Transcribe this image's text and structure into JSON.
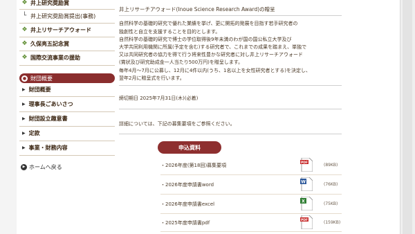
{
  "sidebar": {
    "items_top": [
      {
        "label": "井上研究奨励賞",
        "icon": "leaf-icon"
      },
      {
        "label": "井上研究奨励賞提出(事務)",
        "icon": "corner-arrow-icon"
      },
      {
        "label": "井上リサーチアウォード",
        "icon": "leaf-icon"
      },
      {
        "label": "久保亮五記念賞",
        "icon": "leaf-icon"
      },
      {
        "label": "国際交流事業の援助",
        "icon": "leaf-icon"
      }
    ],
    "section_title": "財団概要",
    "items_sub": [
      "財団概要",
      "理事長ごあいさつ",
      "財団設立趣意書",
      "定款",
      "事業・財務内容"
    ],
    "home_label": "ホームへ戻る"
  },
  "content": {
    "heading": "井上リサーチアウォード(Inoue Science Research Award)の贈呈",
    "para1": [
      "自然科学の基礎的研究で優れた業績を挙げ、更に開拓的発展を目指す若手研究者の",
      "独創性と自立を支援することを目的とします。",
      "自然科学の基礎的研究で博士の学位取得後9年未満のわが国の国公私立大学及び",
      "大学共同利用機関に所属(予定を含む)する研究者で、これまでの成果を踏まえ、単独で",
      "又は共同研究者の協力を得て行う将来性豊かな研究者に対し井上リサーチアウォード",
      "(賞状及び研究助成金一人当たり500万円)を贈呈します。",
      "毎年4月〜7月に公募し、12月に4件以内(うち、1名以上を女性研究者とする)を決定し、",
      "翌年2月に贈呈式を行います。"
    ],
    "deadline": "締切期日 2025年7月31日(木)(必着)",
    "details": "詳細については、下記の募集要項をご参照ください。",
    "apply_button": "申込資料",
    "files": [
      {
        "label": "・2026年度(第18回)募集要項",
        "type": "pdf",
        "badge": "PDF",
        "size": "(89KB)"
      },
      {
        "label": "・2026年度申請書word",
        "type": "word",
        "badge": "W",
        "size": "(76KB)"
      },
      {
        "label": "・2026年度申請書excel",
        "type": "excel",
        "badge": "X",
        "size": "(75KB)"
      },
      {
        "label": "・2025年度申請書pdf",
        "type": "pdf",
        "badge": "PDF",
        "size": "(159KB)"
      }
    ]
  },
  "colors": {
    "accent": "#8e2f2f",
    "leaf": "#5a8a2c",
    "word": "#2b579a",
    "excel": "#2e7d32",
    "pdf": "#c62828"
  }
}
